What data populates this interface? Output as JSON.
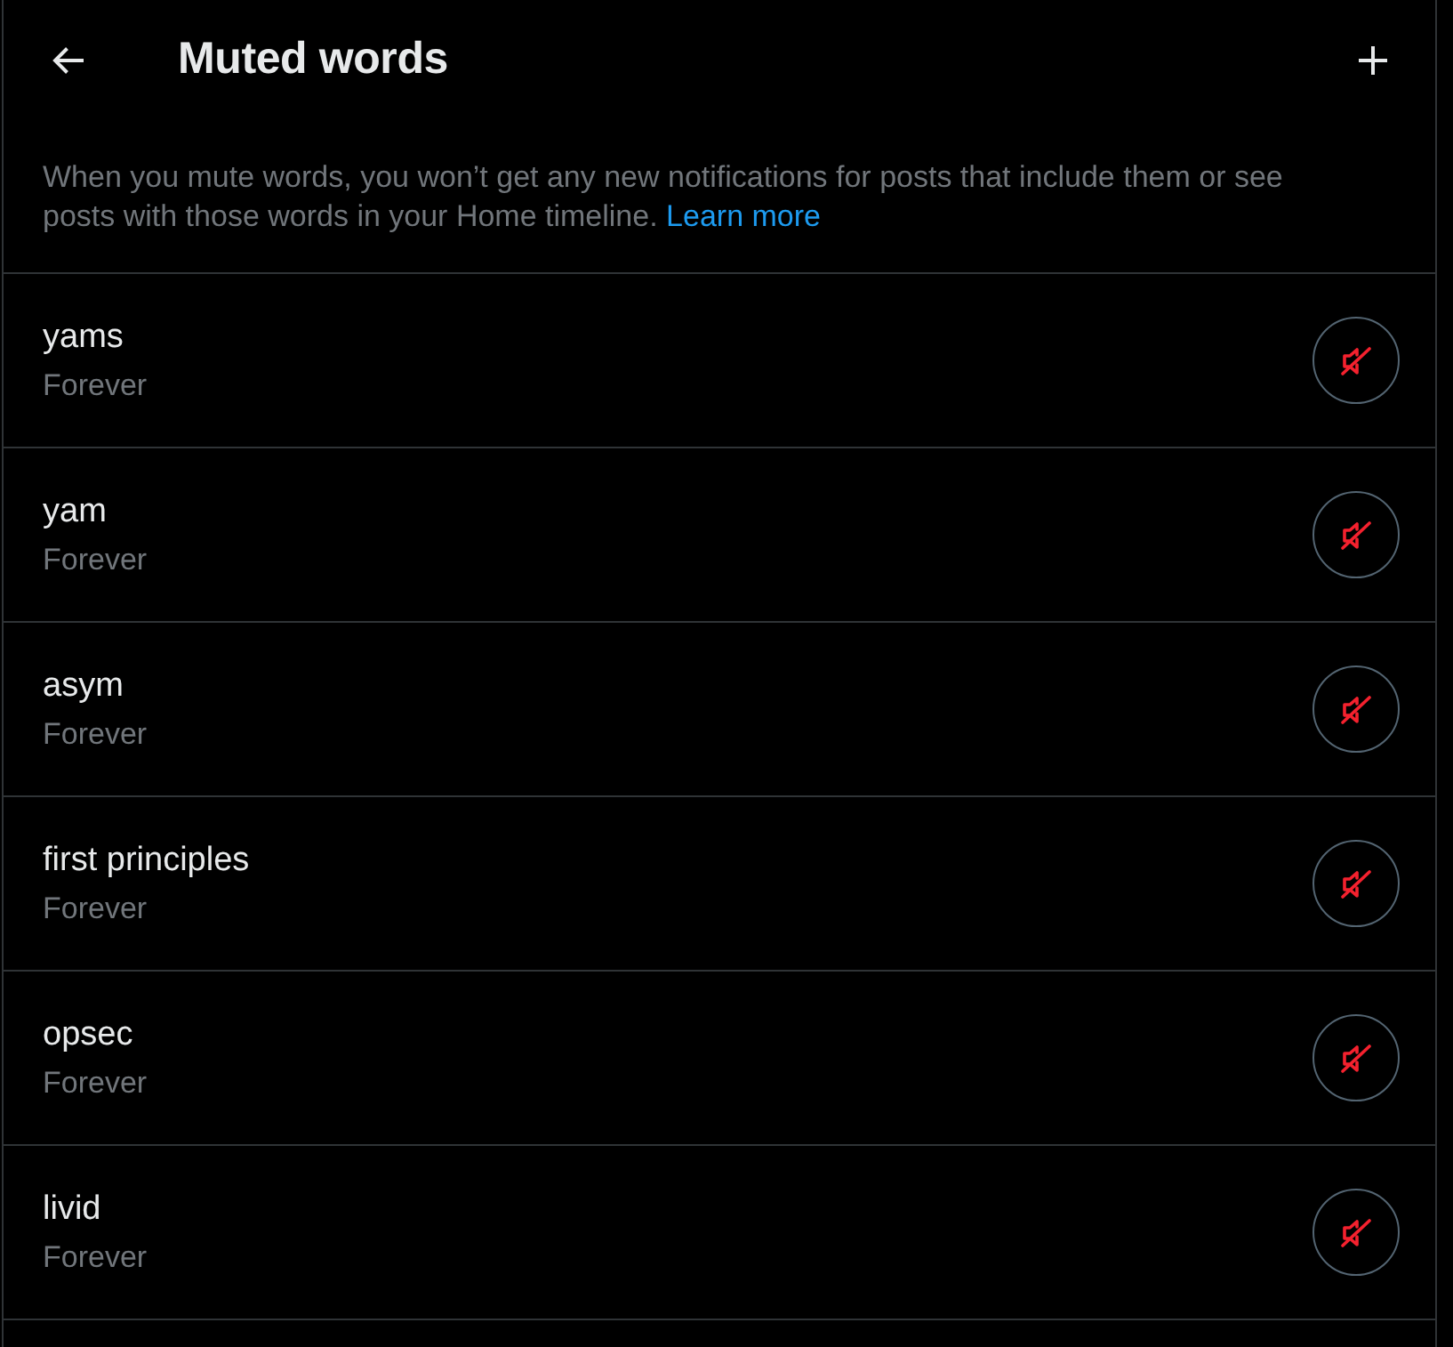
{
  "header": {
    "title": "Muted words"
  },
  "description": {
    "text": "When you mute words, you won’t get any new notifications for posts that include them or see posts with those words in your Home timeline.",
    "link": "Learn more"
  },
  "words": [
    {
      "word": "yams",
      "duration": "Forever",
      "muted": true
    },
    {
      "word": "yam",
      "duration": "Forever",
      "muted": true
    },
    {
      "word": "asym",
      "duration": "Forever",
      "muted": true
    },
    {
      "word": "first principles",
      "duration": "Forever",
      "muted": true
    },
    {
      "word": "opsec",
      "duration": "Forever",
      "muted": true
    },
    {
      "word": "livid",
      "duration": "Forever",
      "muted": true
    }
  ]
}
